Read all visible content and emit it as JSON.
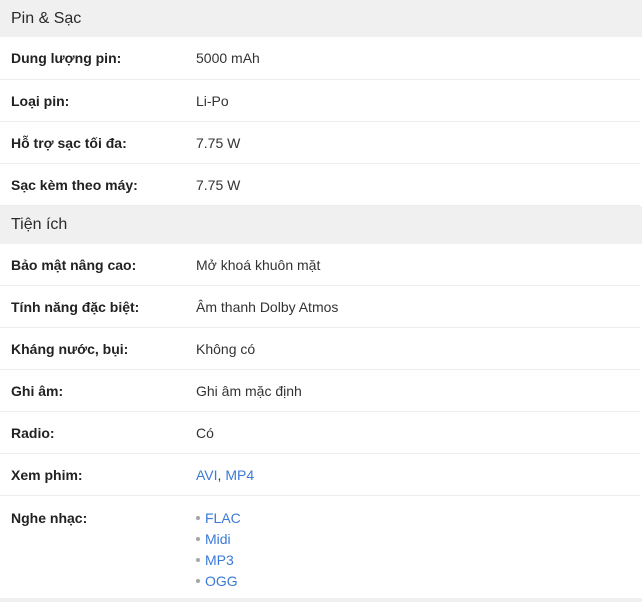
{
  "sections": [
    {
      "title": "Pin & Sạc",
      "rows": [
        {
          "label": "Dung lượng pin:",
          "value": "5000 mAh"
        },
        {
          "label": "Loại pin:",
          "value": "Li-Po"
        },
        {
          "label": "Hỗ trợ sạc tối đa:",
          "value": "7.75 W"
        },
        {
          "label": "Sạc kèm theo máy:",
          "value": "7.75 W"
        }
      ]
    },
    {
      "title": "Tiện ích",
      "rows": [
        {
          "label": "Bảo mật nâng cao:",
          "value": "Mở khoá khuôn mặt"
        },
        {
          "label": "Tính năng đặc biệt:",
          "value": "Âm thanh Dolby Atmos"
        },
        {
          "label": "Kháng nước, bụi:",
          "value": "Không có"
        },
        {
          "label": "Ghi âm:",
          "value": "Ghi âm mặc định"
        },
        {
          "label": "Radio:",
          "value": "Có"
        },
        {
          "label": "Xem phim:",
          "values": [
            "AVI",
            "MP4"
          ],
          "separator": ", "
        },
        {
          "label": "Nghe nhạc:",
          "values": [
            "FLAC",
            "Midi",
            "MP3",
            "OGG"
          ]
        }
      ]
    }
  ],
  "colors": {
    "link": "#3b7ad8",
    "header_bg": "#f0f0f0",
    "bullet": "#a6a6a6"
  }
}
